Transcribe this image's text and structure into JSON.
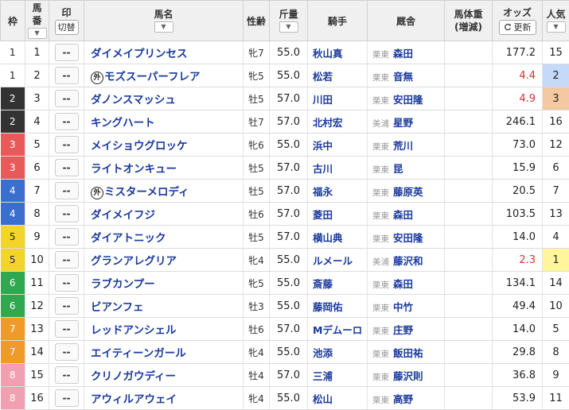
{
  "header": {
    "waku": "枠",
    "umaban_top": "馬",
    "umaban_bottom": "番",
    "mark": "印",
    "mark_toggle": "切替",
    "horse": "馬名",
    "sexage": "性齢",
    "weight": "斤量",
    "jockey": "騎手",
    "trainer": "厩舎",
    "body_top": "馬体重",
    "body_bottom": "(増減)",
    "odds": "オッズ",
    "refresh": "更新",
    "pop": "人気",
    "sort_glyph": "▼"
  },
  "colors": {
    "waku_1": "#ffffff",
    "waku_2": "#333333",
    "waku_3": "#e85a5a",
    "waku_4": "#3a6fd0",
    "waku_5": "#f2d42a",
    "waku_6": "#2fa84f",
    "waku_7": "#f09a2a",
    "waku_8": "#f0a0b0",
    "pop_1": "#fff59a",
    "pop_2": "#c5d9f8",
    "pop_3": "#f4c8a0",
    "hot_odds": "#d63333",
    "link": "#1a3a9c"
  },
  "rows": [
    {
      "waku": "1",
      "umaban": "1",
      "mark": "--",
      "foreign": "",
      "horse": "ダイメイプリンセス",
      "sexage": "牝7",
      "weight": "55.0",
      "jockey": "秋山真",
      "region": "栗東",
      "trainer": "森田",
      "odds": "177.2",
      "pop": "15"
    },
    {
      "waku": "1",
      "umaban": "2",
      "mark": "--",
      "foreign": "外",
      "horse": "モズスーパーフレア",
      "sexage": "牝5",
      "weight": "55.0",
      "jockey": "松若",
      "region": "栗東",
      "trainer": "音無",
      "odds": "4.4",
      "pop": "2"
    },
    {
      "waku": "2",
      "umaban": "3",
      "mark": "--",
      "foreign": "",
      "horse": "ダノンスマッシュ",
      "sexage": "牡5",
      "weight": "57.0",
      "jockey": "川田",
      "region": "栗東",
      "trainer": "安田隆",
      "odds": "4.9",
      "pop": "3"
    },
    {
      "waku": "2",
      "umaban": "4",
      "mark": "--",
      "foreign": "",
      "horse": "キングハート",
      "sexage": "牡7",
      "weight": "57.0",
      "jockey": "北村宏",
      "region": "美浦",
      "trainer": "星野",
      "odds": "246.1",
      "pop": "16"
    },
    {
      "waku": "3",
      "umaban": "5",
      "mark": "--",
      "foreign": "",
      "horse": "メイショウグロッケ",
      "sexage": "牝6",
      "weight": "55.0",
      "jockey": "浜中",
      "region": "栗東",
      "trainer": "荒川",
      "odds": "73.0",
      "pop": "12"
    },
    {
      "waku": "3",
      "umaban": "6",
      "mark": "--",
      "foreign": "",
      "horse": "ライトオンキュー",
      "sexage": "牡5",
      "weight": "57.0",
      "jockey": "古川",
      "region": "栗東",
      "trainer": "昆",
      "odds": "15.9",
      "pop": "6"
    },
    {
      "waku": "4",
      "umaban": "7",
      "mark": "--",
      "foreign": "外",
      "horse": "ミスターメロディ",
      "sexage": "牡5",
      "weight": "57.0",
      "jockey": "福永",
      "region": "栗東",
      "trainer": "藤原英",
      "odds": "20.5",
      "pop": "7"
    },
    {
      "waku": "4",
      "umaban": "8",
      "mark": "--",
      "foreign": "",
      "horse": "ダイメイフジ",
      "sexage": "牡6",
      "weight": "57.0",
      "jockey": "菱田",
      "region": "栗東",
      "trainer": "森田",
      "odds": "103.5",
      "pop": "13"
    },
    {
      "waku": "5",
      "umaban": "9",
      "mark": "--",
      "foreign": "",
      "horse": "ダイアトニック",
      "sexage": "牡5",
      "weight": "57.0",
      "jockey": "横山典",
      "region": "栗東",
      "trainer": "安田隆",
      "odds": "14.0",
      "pop": "4"
    },
    {
      "waku": "5",
      "umaban": "10",
      "mark": "--",
      "foreign": "",
      "horse": "グランアレグリア",
      "sexage": "牝4",
      "weight": "55.0",
      "jockey": "ルメール",
      "region": "美浦",
      "trainer": "藤沢和",
      "odds": "2.3",
      "pop": "1"
    },
    {
      "waku": "6",
      "umaban": "11",
      "mark": "--",
      "foreign": "",
      "horse": "ラブカンプー",
      "sexage": "牝5",
      "weight": "55.0",
      "jockey": "斎藤",
      "region": "栗東",
      "trainer": "森田",
      "odds": "134.1",
      "pop": "14"
    },
    {
      "waku": "6",
      "umaban": "12",
      "mark": "--",
      "foreign": "",
      "horse": "ビアンフェ",
      "sexage": "牡3",
      "weight": "55.0",
      "jockey": "藤岡佑",
      "region": "栗東",
      "trainer": "中竹",
      "odds": "49.4",
      "pop": "10"
    },
    {
      "waku": "7",
      "umaban": "13",
      "mark": "--",
      "foreign": "",
      "horse": "レッドアンシェル",
      "sexage": "牡6",
      "weight": "57.0",
      "jockey": "Mデムーロ",
      "region": "栗東",
      "trainer": "庄野",
      "odds": "14.0",
      "pop": "5"
    },
    {
      "waku": "7",
      "umaban": "14",
      "mark": "--",
      "foreign": "",
      "horse": "エイティーンガール",
      "sexage": "牝4",
      "weight": "55.0",
      "jockey": "池添",
      "region": "栗東",
      "trainer": "飯田祐",
      "odds": "29.8",
      "pop": "8"
    },
    {
      "waku": "8",
      "umaban": "15",
      "mark": "--",
      "foreign": "",
      "horse": "クリノガウディー",
      "sexage": "牡4",
      "weight": "57.0",
      "jockey": "三浦",
      "region": "栗東",
      "trainer": "藤沢則",
      "odds": "36.8",
      "pop": "9"
    },
    {
      "waku": "8",
      "umaban": "16",
      "mark": "--",
      "foreign": "",
      "horse": "アウィルアウェイ",
      "sexage": "牝4",
      "weight": "55.0",
      "jockey": "松山",
      "region": "栗東",
      "trainer": "高野",
      "odds": "53.9",
      "pop": "11"
    }
  ]
}
